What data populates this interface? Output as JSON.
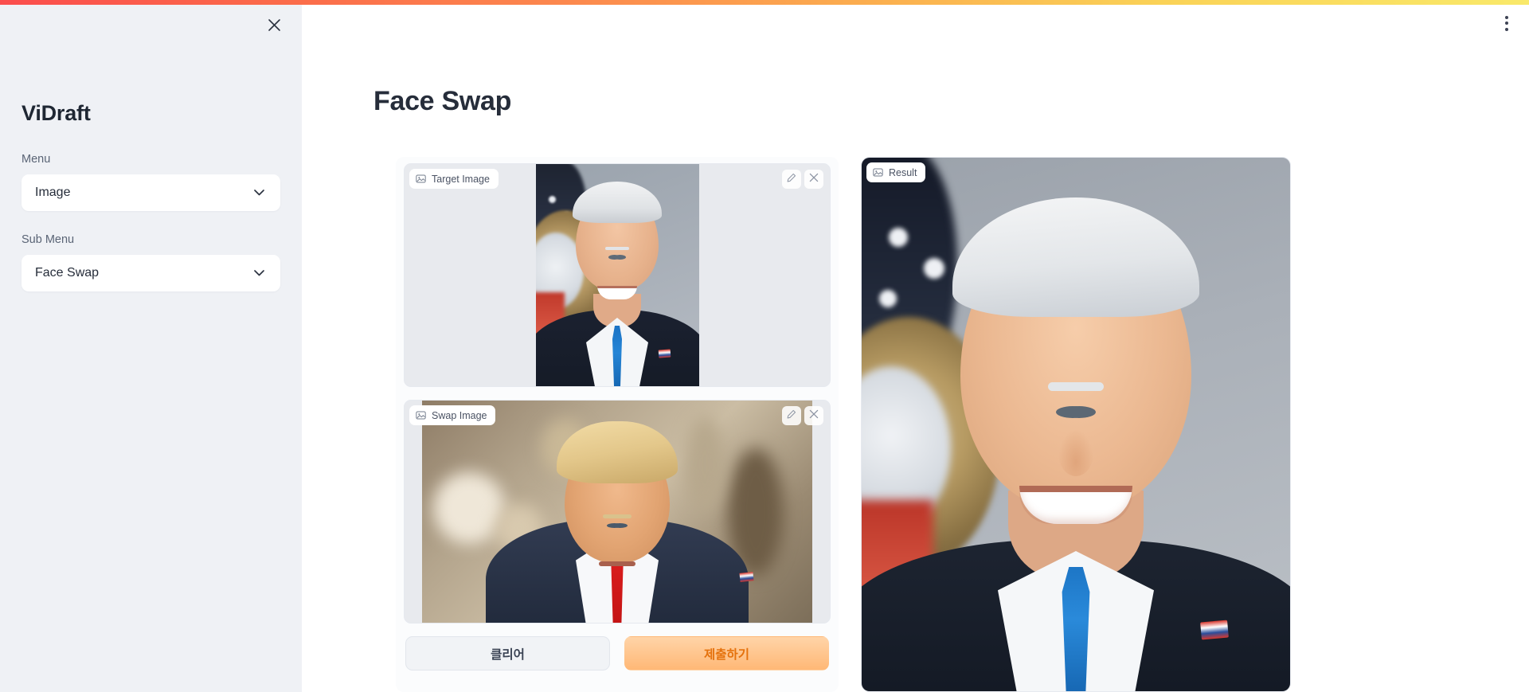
{
  "window": {
    "accent_gradient_start": "#fb4d4d",
    "accent_gradient_end": "#f9e96a",
    "kebab_icon": "kebab-menu-icon"
  },
  "sidebar": {
    "close_icon": "close-icon",
    "app_title": "ViDraft",
    "fields": [
      {
        "label": "Menu",
        "value": "Image",
        "chevron_icon": "chevron-down-icon"
      },
      {
        "label": "Sub Menu",
        "value": "Face Swap",
        "chevron_icon": "chevron-down-icon"
      }
    ]
  },
  "main": {
    "page_title": "Face Swap",
    "panels": {
      "target": {
        "badge_label": "Target Image",
        "badge_icon": "image-icon",
        "edit_icon": "pencil-icon",
        "remove_icon": "close-icon"
      },
      "swap": {
        "badge_label": "Swap Image",
        "badge_icon": "image-icon",
        "edit_icon": "pencil-icon",
        "remove_icon": "close-icon"
      },
      "result": {
        "badge_label": "Result",
        "badge_icon": "image-icon"
      }
    },
    "actions": {
      "clear_label": "클리어",
      "submit_label": "제출하기",
      "submit_bg_start": "#ffd4a8",
      "submit_bg_end": "#ffb876",
      "submit_text_color": "#e5720d"
    }
  }
}
